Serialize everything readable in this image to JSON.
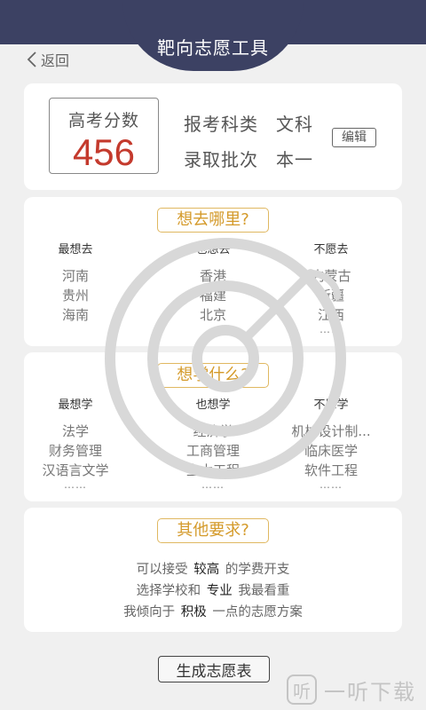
{
  "header": {
    "title": "靶向志愿工具",
    "back_label": "返回"
  },
  "score": {
    "label": "高考分数",
    "value": "456"
  },
  "info": {
    "subject_label": "报考科类",
    "subject_value": "文科",
    "batch_label": "录取批次",
    "batch_value": "本一",
    "edit_label": "编辑"
  },
  "where": {
    "title": "想去哪里?",
    "columns": [
      {
        "head": "最想去",
        "items": [
          "河南",
          "贵州",
          "海南"
        ],
        "more": ""
      },
      {
        "head": "也想去",
        "items": [
          "香港",
          "福建",
          "北京"
        ],
        "more": ""
      },
      {
        "head": "不愿去",
        "items": [
          "内蒙古",
          "新疆",
          "江西"
        ],
        "more": "……"
      }
    ]
  },
  "study": {
    "title": "想学什么?",
    "columns": [
      {
        "head": "最想学",
        "items": [
          "法学",
          "财务管理",
          "汉语言文学"
        ],
        "more": "……"
      },
      {
        "head": "也想学",
        "items": [
          "经济学",
          "工商管理",
          "土木工程"
        ],
        "more": "……"
      },
      {
        "head": "不愿学",
        "items": [
          "机械设计制...",
          "临床医学",
          "软件工程"
        ],
        "more": "……"
      }
    ]
  },
  "other": {
    "title": "其他要求?",
    "lines": [
      {
        "pre": "可以接受",
        "key": "较高",
        "post": "的学费开支"
      },
      {
        "pre": "选择学校和",
        "key": "专业",
        "post": "我最看重"
      },
      {
        "pre": "我倾向于",
        "key": "积极",
        "post": "一点的志愿方案"
      }
    ]
  },
  "generate_label": "生成志愿表",
  "logo": {
    "mark": "听",
    "text": "一听下载"
  },
  "colors": {
    "header": "#3c4163",
    "score": "#c43a2d",
    "accent": "#d49a2a"
  }
}
